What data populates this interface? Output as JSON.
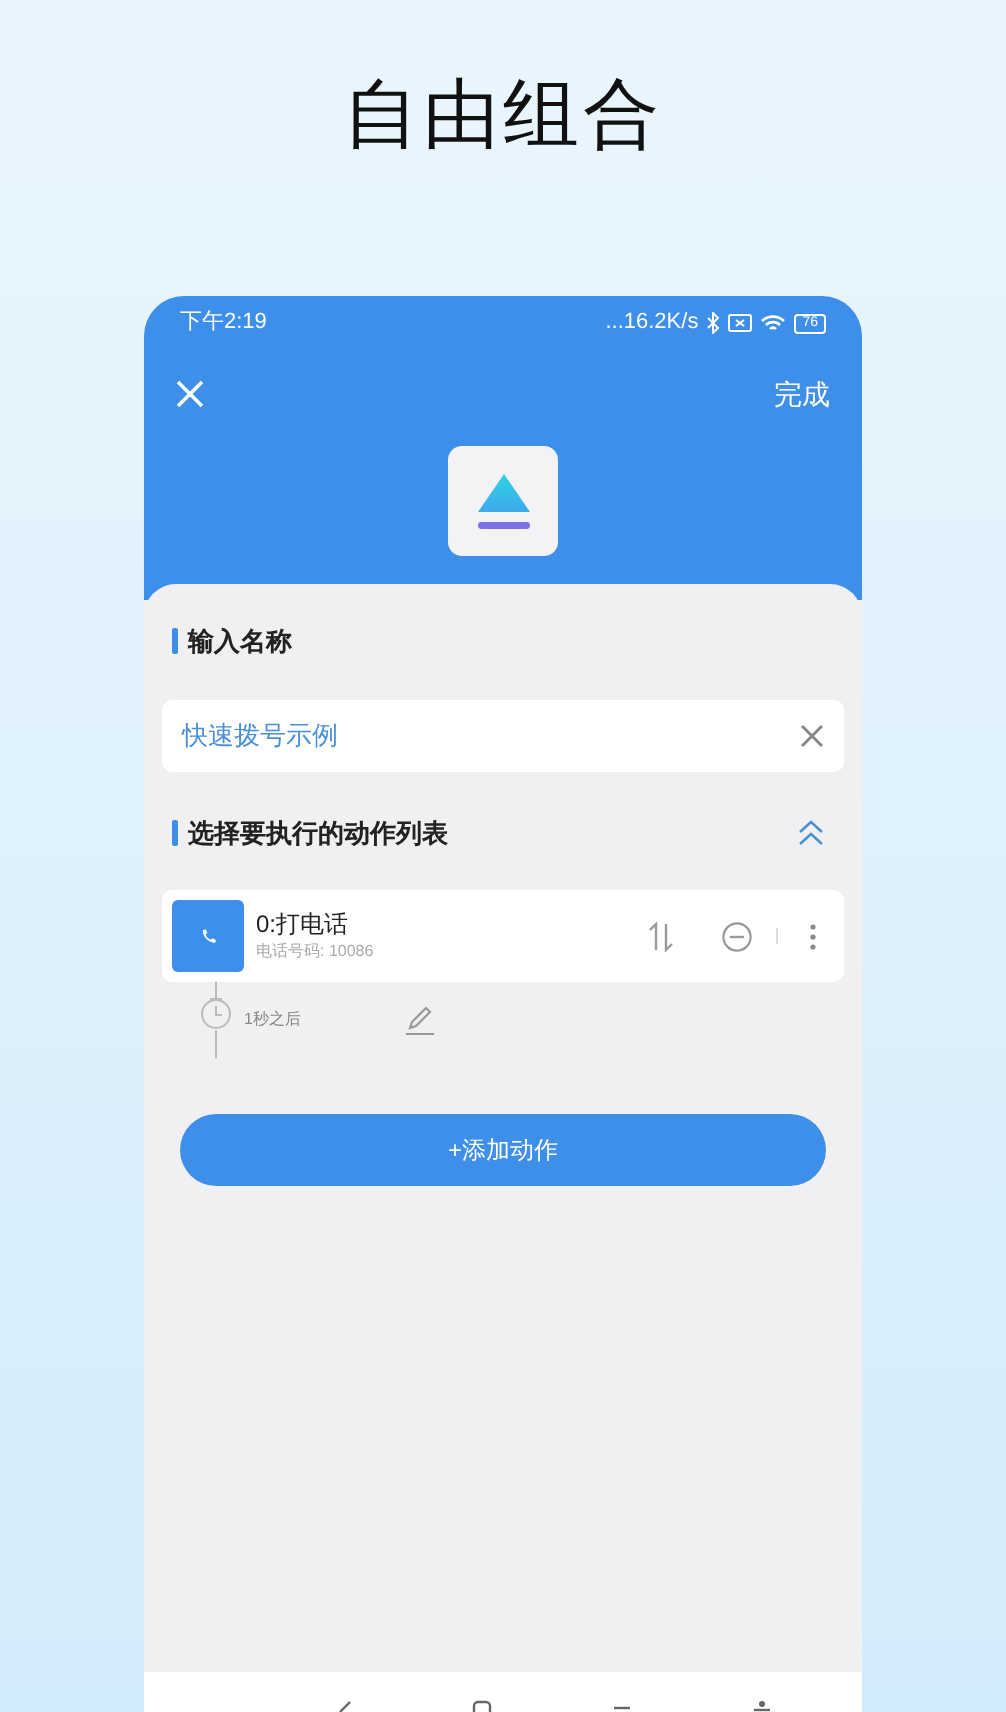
{
  "headline": "自由组合",
  "status_bar": {
    "time": "下午2:19",
    "network_speed": "...16.2K/s",
    "battery": "76"
  },
  "header": {
    "done": "完成"
  },
  "name_section": {
    "title": "输入名称",
    "field_value": "快速拨号示例"
  },
  "actions_section": {
    "title": "选择要执行的动作列表",
    "expanded": true
  },
  "actions": [
    {
      "title": "0:打电话",
      "detail": "电话号码: 10086",
      "delay": "1秒之后"
    }
  ],
  "add_button": "+添加动作"
}
